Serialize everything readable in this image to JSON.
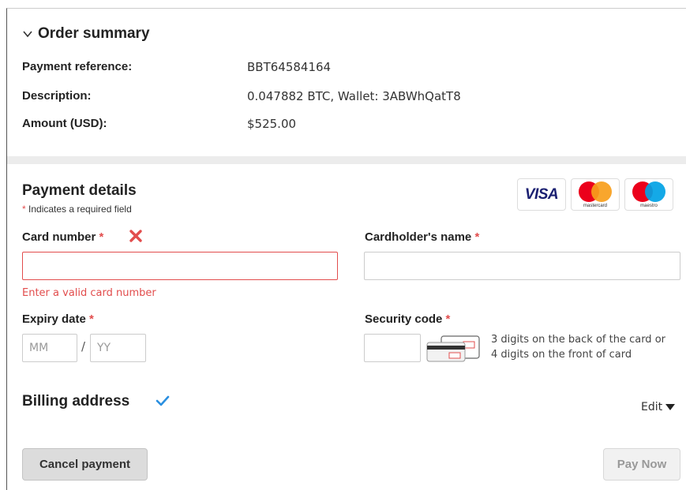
{
  "order_summary": {
    "title": "Order summary",
    "rows": [
      {
        "label": "Payment reference:",
        "value": "BBT64584164"
      },
      {
        "label": "Description:",
        "value": "0.047882 BTC, Wallet: 3ABWhQatT8"
      },
      {
        "label": "Amount (USD):",
        "value": "$525.00"
      }
    ]
  },
  "payment_details": {
    "title": "Payment details",
    "required_star": "*",
    "required_note": " Indicates a required field",
    "card_logos": {
      "visa": "VISA",
      "mastercard": "mastercard",
      "maestro": "maestro"
    },
    "card_number": {
      "label": "Card number",
      "value": "",
      "placeholder": "",
      "error": "Enter a valid card number"
    },
    "cardholder_name": {
      "label": "Cardholder's name",
      "value": "",
      "placeholder": ""
    },
    "expiry_date": {
      "label": "Expiry date",
      "month_placeholder": "MM",
      "separator": "/",
      "year_placeholder": "YY"
    },
    "security_code": {
      "label": "Security code",
      "value": "",
      "hint_line1": "3 digits on the back of the card or",
      "hint_line2": "4 digits on the front of card"
    }
  },
  "billing": {
    "title": "Billing address",
    "edit_label": "Edit"
  },
  "actions": {
    "cancel_label": "Cancel payment",
    "pay_label": "Pay Now"
  },
  "colors": {
    "error": "#e24d4d",
    "check": "#2a8fe0",
    "visa": "#1a1f71",
    "mc_red": "#eb001b",
    "mc_orange": "#f79e1b",
    "maestro_blue": "#00a2e5"
  }
}
